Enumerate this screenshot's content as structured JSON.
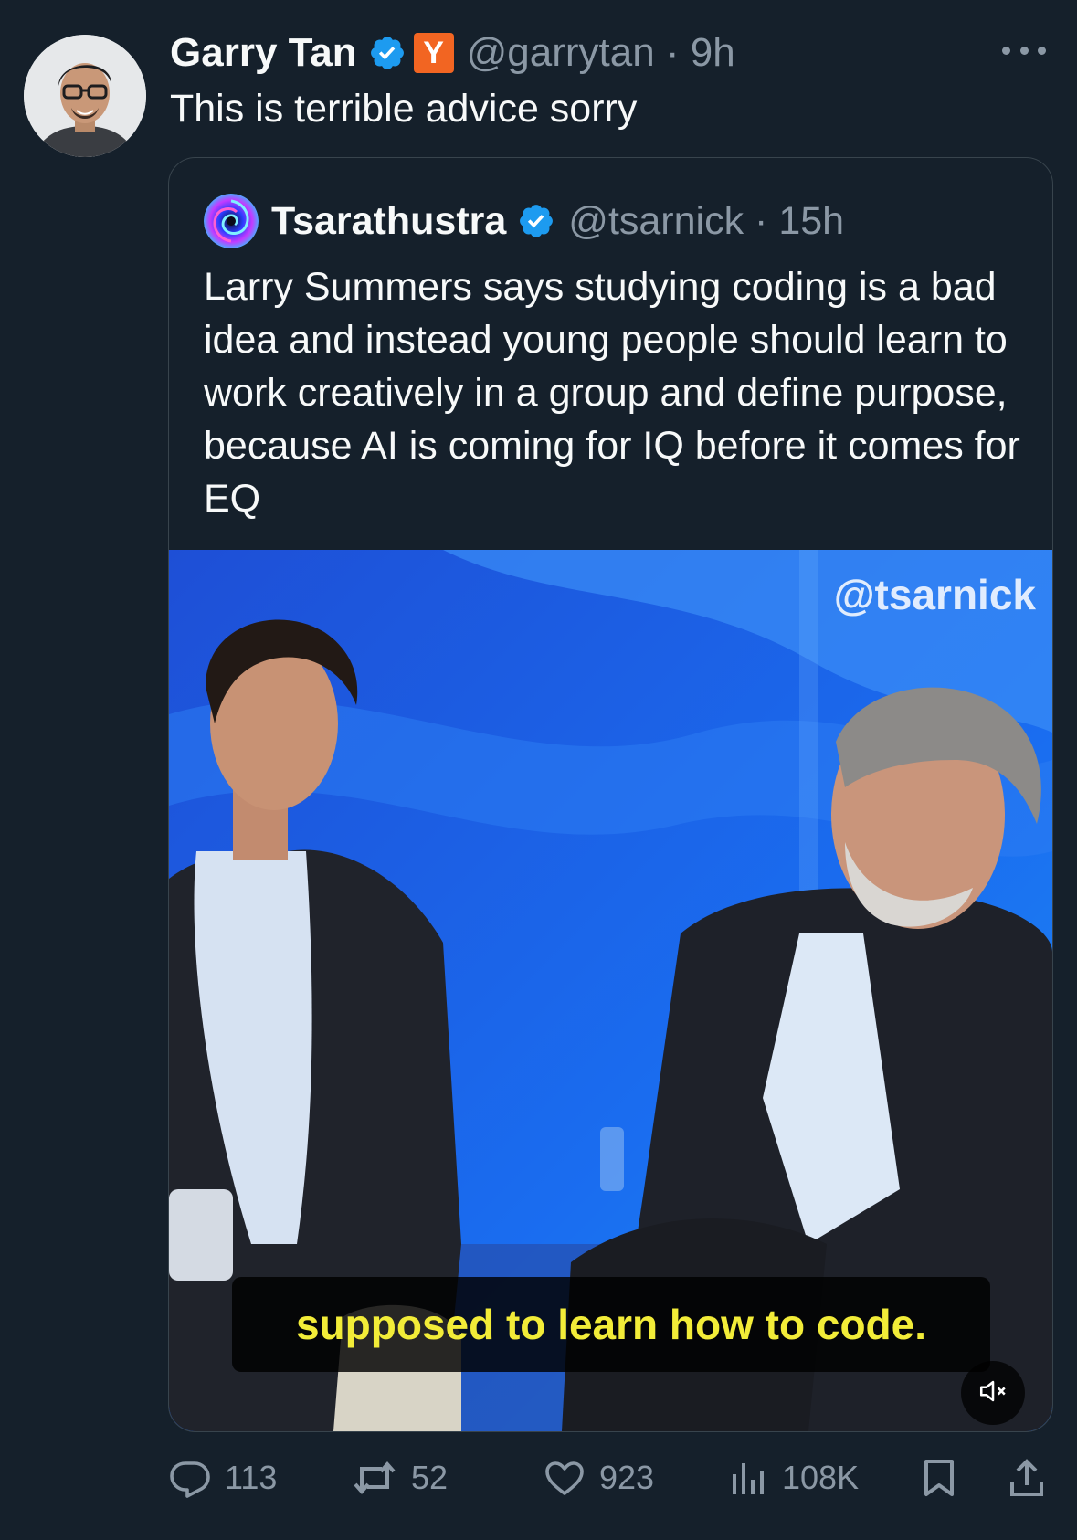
{
  "tweet": {
    "author_name": "Garry Tan",
    "author_handle": "@garrytan",
    "time": "9h",
    "affiliate_badge": "Y",
    "text": "This is terrible advice sorry",
    "verified_icon": "verified-badge-icon",
    "more_icon": "more-options-icon"
  },
  "quote": {
    "author_name": "Tsarathustra",
    "author_handle": "@tsarnick",
    "time": "15h",
    "text": "Larry Summers says studying coding is a bad idea and instead young people should learn to work creatively in a group and define purpose, because AI is coming for IQ before it comes for EQ",
    "media": {
      "watermark": "@tsarnick",
      "caption": "supposed to learn how to code.",
      "mute_icon": "speaker-muted-icon"
    }
  },
  "actions": {
    "replies": "113",
    "retweets": "52",
    "likes": "923",
    "views": "108K",
    "icons": [
      "reply-icon",
      "retweet-icon",
      "like-icon",
      "views-icon",
      "bookmark-icon",
      "share-icon"
    ]
  },
  "colors": {
    "background": "#15202b",
    "text_primary": "#f7f9f9",
    "text_secondary": "#8b98a5",
    "verified": "#1d9bf0",
    "border": "#38444d",
    "ycombinator": "#f26522",
    "caption_text": "#f2ec38"
  }
}
